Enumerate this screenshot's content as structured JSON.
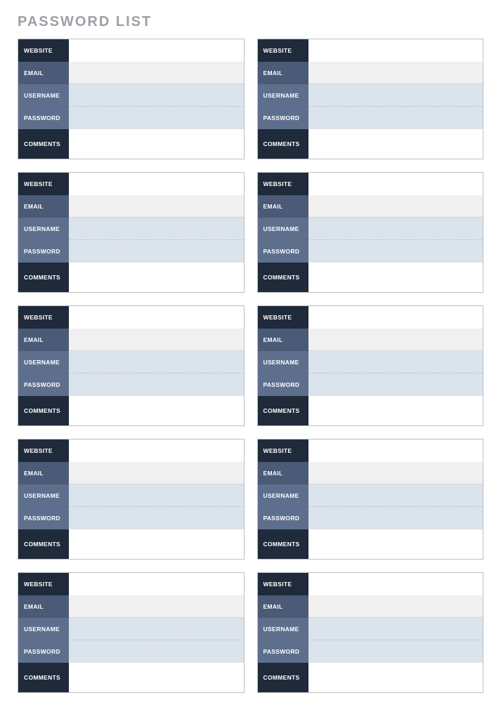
{
  "title": "PASSWORD LIST",
  "labels": {
    "website": "WEBSITE",
    "email": "EMAIL",
    "username": "USERNAME",
    "password": "PASSWORD",
    "comments": "COMMENTS"
  },
  "entries": [
    {
      "website": "",
      "email": "",
      "username": "",
      "password": "",
      "comments": ""
    },
    {
      "website": "",
      "email": "",
      "username": "",
      "password": "",
      "comments": ""
    },
    {
      "website": "",
      "email": "",
      "username": "",
      "password": "",
      "comments": ""
    },
    {
      "website": "",
      "email": "",
      "username": "",
      "password": "",
      "comments": ""
    },
    {
      "website": "",
      "email": "",
      "username": "",
      "password": "",
      "comments": ""
    },
    {
      "website": "",
      "email": "",
      "username": "",
      "password": "",
      "comments": ""
    },
    {
      "website": "",
      "email": "",
      "username": "",
      "password": "",
      "comments": ""
    },
    {
      "website": "",
      "email": "",
      "username": "",
      "password": "",
      "comments": ""
    },
    {
      "website": "",
      "email": "",
      "username": "",
      "password": "",
      "comments": ""
    },
    {
      "website": "",
      "email": "",
      "username": "",
      "password": "",
      "comments": ""
    }
  ]
}
